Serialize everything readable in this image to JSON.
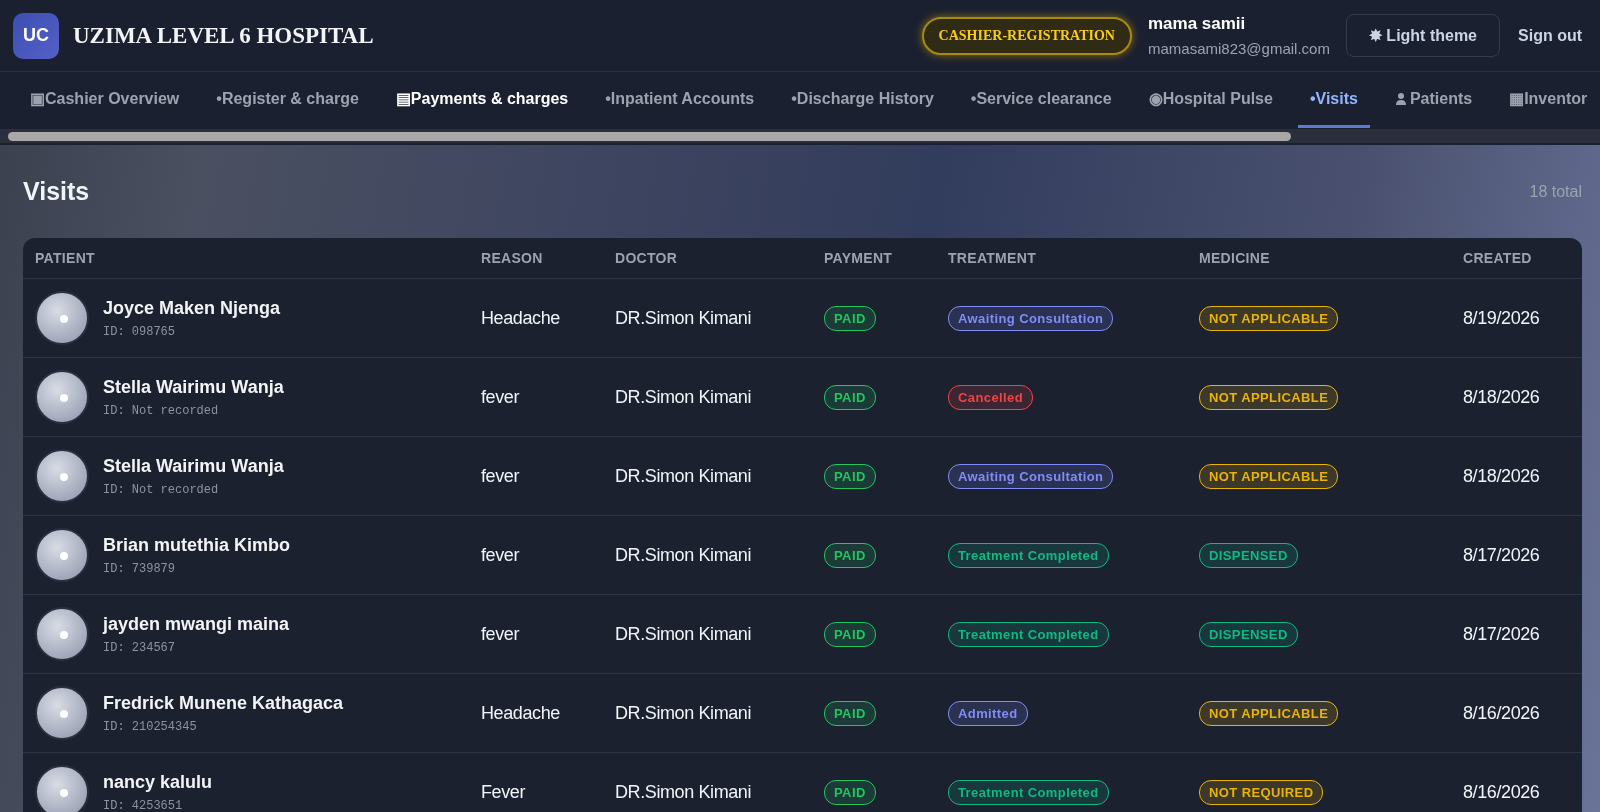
{
  "header": {
    "logo": "UC",
    "title": "UZIMA LEVEL 6 HOSPITAL",
    "role": "CASHIER-REGISTRATION",
    "user_name": "mama samii",
    "user_email": "mamasami823@gmail.com",
    "theme_button": "✸ Light theme",
    "sign_out": "Sign out"
  },
  "nav": {
    "tabs": [
      {
        "label": "▣Cashier Overview",
        "selected": false,
        "highlighted": false,
        "person_icon": false
      },
      {
        "label": "•Register & charge",
        "selected": false,
        "highlighted": false,
        "person_icon": false
      },
      {
        "label": "▤Payments & charges",
        "selected": false,
        "highlighted": true,
        "person_icon": false
      },
      {
        "label": "•Inpatient Accounts",
        "selected": false,
        "highlighted": false,
        "person_icon": false
      },
      {
        "label": "•Discharge History",
        "selected": false,
        "highlighted": false,
        "person_icon": false
      },
      {
        "label": "•Service clearance",
        "selected": false,
        "highlighted": false,
        "person_icon": false
      },
      {
        "label": "◉Hospital Pulse",
        "selected": false,
        "highlighted": false,
        "person_icon": false
      },
      {
        "label": "•Visits",
        "selected": true,
        "highlighted": false,
        "person_icon": false
      },
      {
        "label": "Patients",
        "selected": false,
        "highlighted": false,
        "person_icon": true
      },
      {
        "label": "▦Inventor",
        "selected": false,
        "highlighted": false,
        "person_icon": false
      }
    ]
  },
  "page": {
    "title": "Visits",
    "total": "18 total"
  },
  "table": {
    "columns": [
      "PATIENT",
      "REASON",
      "DOCTOR",
      "PAYMENT",
      "TREATMENT",
      "MEDICINE",
      "CREATED"
    ],
    "rows": [
      {
        "name": "Joyce Maken Njenga",
        "id": "ID: 098765",
        "reason": "Headache",
        "doctor": "DR.Simon Kimani",
        "payment": {
          "label": "PAID",
          "color": "#22c55e"
        },
        "treatment": {
          "label": "Awaiting Consultation",
          "color": "#818cf8"
        },
        "medicine": {
          "label": "NOT APPLICABLE",
          "color": "#eab308"
        },
        "created": "8/19/2026"
      },
      {
        "name": "Stella Wairimu Wanja",
        "id": "ID: Not recorded",
        "reason": "fever",
        "doctor": "DR.Simon Kimani",
        "payment": {
          "label": "PAID",
          "color": "#22c55e"
        },
        "treatment": {
          "label": "Cancelled",
          "color": "#ef4444"
        },
        "medicine": {
          "label": "NOT APPLICABLE",
          "color": "#eab308"
        },
        "created": "8/18/2026"
      },
      {
        "name": "Stella Wairimu Wanja",
        "id": "ID: Not recorded",
        "reason": "fever",
        "doctor": "DR.Simon Kimani",
        "payment": {
          "label": "PAID",
          "color": "#22c55e"
        },
        "treatment": {
          "label": "Awaiting Consultation",
          "color": "#818cf8"
        },
        "medicine": {
          "label": "NOT APPLICABLE",
          "color": "#eab308"
        },
        "created": "8/18/2026"
      },
      {
        "name": "Brian mutethia Kimbo",
        "id": "ID: 739879",
        "reason": "fever",
        "doctor": "DR.Simon Kimani",
        "payment": {
          "label": "PAID",
          "color": "#22c55e"
        },
        "treatment": {
          "label": "Treatment Completed",
          "color": "#10b981"
        },
        "medicine": {
          "label": "DISPENSED",
          "color": "#10b981"
        },
        "created": "8/17/2026"
      },
      {
        "name": "jayden mwangi maina",
        "id": "ID: 234567",
        "reason": "fever",
        "doctor": "DR.Simon Kimani",
        "payment": {
          "label": "PAID",
          "color": "#22c55e"
        },
        "treatment": {
          "label": "Treatment Completed",
          "color": "#10b981"
        },
        "medicine": {
          "label": "DISPENSED",
          "color": "#10b981"
        },
        "created": "8/17/2026"
      },
      {
        "name": "Fredrick Munene Kathagaca",
        "id": "ID: 210254345",
        "reason": "Headache",
        "doctor": "DR.Simon Kimani",
        "payment": {
          "label": "PAID",
          "color": "#22c55e"
        },
        "treatment": {
          "label": "Admitted",
          "color": "#818cf8"
        },
        "medicine": {
          "label": "NOT APPLICABLE",
          "color": "#eab308"
        },
        "created": "8/16/2026"
      },
      {
        "name": "nancy kalulu",
        "id": "ID: 4253651",
        "reason": "Fever",
        "doctor": "DR.Simon Kimani",
        "payment": {
          "label": "PAID",
          "color": "#22c55e"
        },
        "treatment": {
          "label": "Treatment Completed",
          "color": "#10b981"
        },
        "medicine": {
          "label": "NOT REQUIRED",
          "color": "#eab308"
        },
        "created": "8/16/2026"
      }
    ]
  }
}
